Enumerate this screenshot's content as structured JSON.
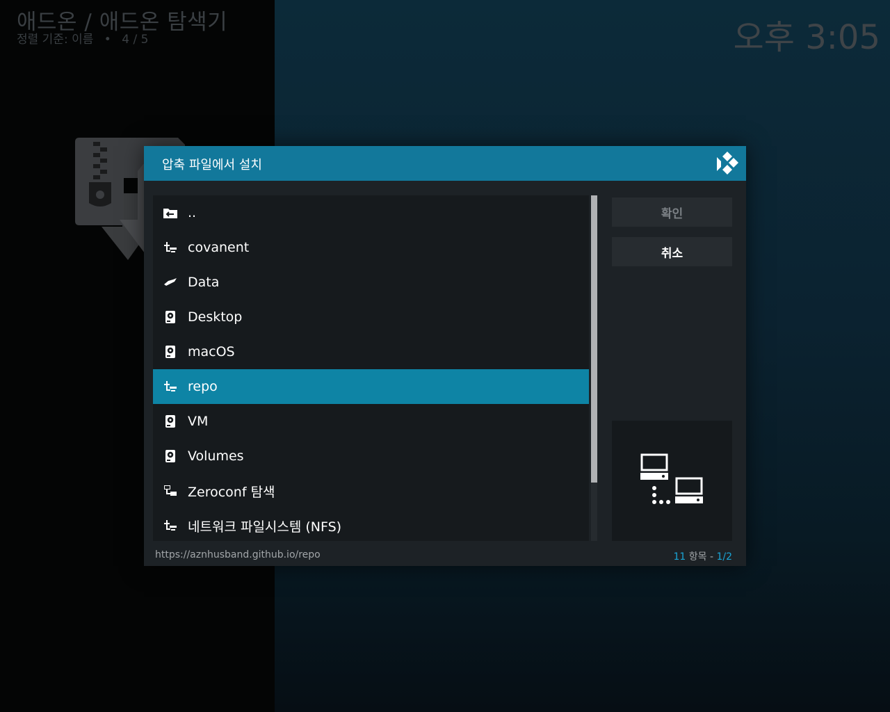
{
  "header": {
    "breadcrumb": "애드온 / 애드온 탐색기",
    "sort_label": "정렬 기준: 이름",
    "sort_separator": "•",
    "position": "4 / 5",
    "clock": "오후 3:05"
  },
  "dialog": {
    "title": "압축 파일에서 설치",
    "items": [
      {
        "label": "..",
        "icon": "folder-back-icon"
      },
      {
        "label": "covanent",
        "icon": "network-share-icon"
      },
      {
        "label": "Data",
        "icon": "data-icon"
      },
      {
        "label": "Desktop",
        "icon": "hard-drive-icon"
      },
      {
        "label": "macOS",
        "icon": "hard-drive-icon"
      },
      {
        "label": "repo",
        "icon": "network-share-icon",
        "selected": true
      },
      {
        "label": "VM",
        "icon": "hard-drive-icon"
      },
      {
        "label": "Volumes",
        "icon": "hard-drive-icon"
      },
      {
        "label": "Zeroconf 탐색",
        "icon": "network-browse-icon"
      },
      {
        "label": "네트워크 파일시스템 (NFS)",
        "icon": "network-share-icon"
      }
    ],
    "ok_label": "확인",
    "cancel_label": "취소",
    "path": "https://aznhusband.github.io/repo",
    "count": "11",
    "count_suffix": "항목 -",
    "page": "1/2",
    "scroll_fraction": 0.83,
    "colors": {
      "header": "#12789b",
      "selected_row": "#0e84a5",
      "highlight_text": "#1aa5d6"
    }
  }
}
